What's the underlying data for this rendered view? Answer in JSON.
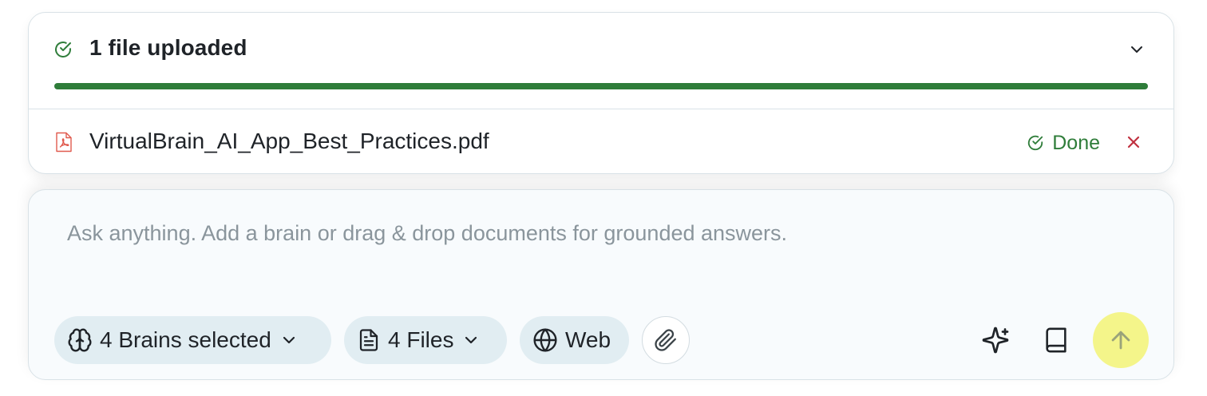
{
  "upload": {
    "title": "1 file uploaded",
    "progress_percent": 100,
    "progress_color": "#2f7d3a",
    "file": {
      "name": "VirtualBrain_AI_App_Best_Practices.pdf",
      "file_icon": "pdf-icon",
      "status": "Done",
      "status_color": "#2f7d3a",
      "remove_icon": "close-icon"
    }
  },
  "composer": {
    "placeholder": "Ask anything. Add a brain or drag & drop documents for grounded answers.",
    "value": "",
    "chips": {
      "brains": "4 Brains selected",
      "files": "4 Files",
      "web": "Web"
    },
    "icons": [
      "brain-icon",
      "document-icon",
      "globe-icon",
      "paperclip-icon",
      "sparkles-icon",
      "book-icon",
      "arrow-up-icon"
    ],
    "send_button_color": "#f4f58a"
  }
}
